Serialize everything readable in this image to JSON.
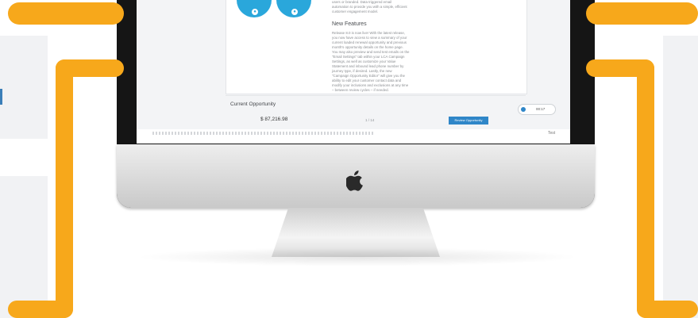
{
  "screen": {
    "features_title": "New Features",
    "intro_text_lines": [
      "",
      "",
      "users or branded. Data triggered email",
      "automation to provide you with a simple, efficient",
      "customer engagement model."
    ],
    "features_body_lines": [
      "Release 8.0 is now live! With the latest release,",
      "you now have access to view a summary of your",
      "current loaded renewal opportunity and previous",
      "month's opportunity details on the home page.",
      "You may also preview and send test emails on the",
      "\"Email Settings\" tab within your LCA Campaign",
      "Settings, as well as customize your Value",
      "Statement and inbound lead phone number by",
      "journey type, if desired. Lastly, the new",
      "\"Campaign Opportunity Editor\" will give you the",
      "ability to edit your customer contact data and",
      "modify your inclusions and exclusions at any time",
      "– between review cycles – if needed."
    ],
    "opportunity_title": "Current Opportunity",
    "opportunity_amount": "$ 87,216.98",
    "page_indicator": "1 / 14",
    "review_button": "Review Opportunity",
    "timer_value": "00:17",
    "status_right": "Test"
  },
  "colors": {
    "accent_orange": "#f7a81b",
    "circle_blue": "#2aa7db",
    "button_blue": "#2f86c8"
  },
  "icons": [
    "apple-logo-icon",
    "timer-icon",
    "circle-badge-icon"
  ]
}
